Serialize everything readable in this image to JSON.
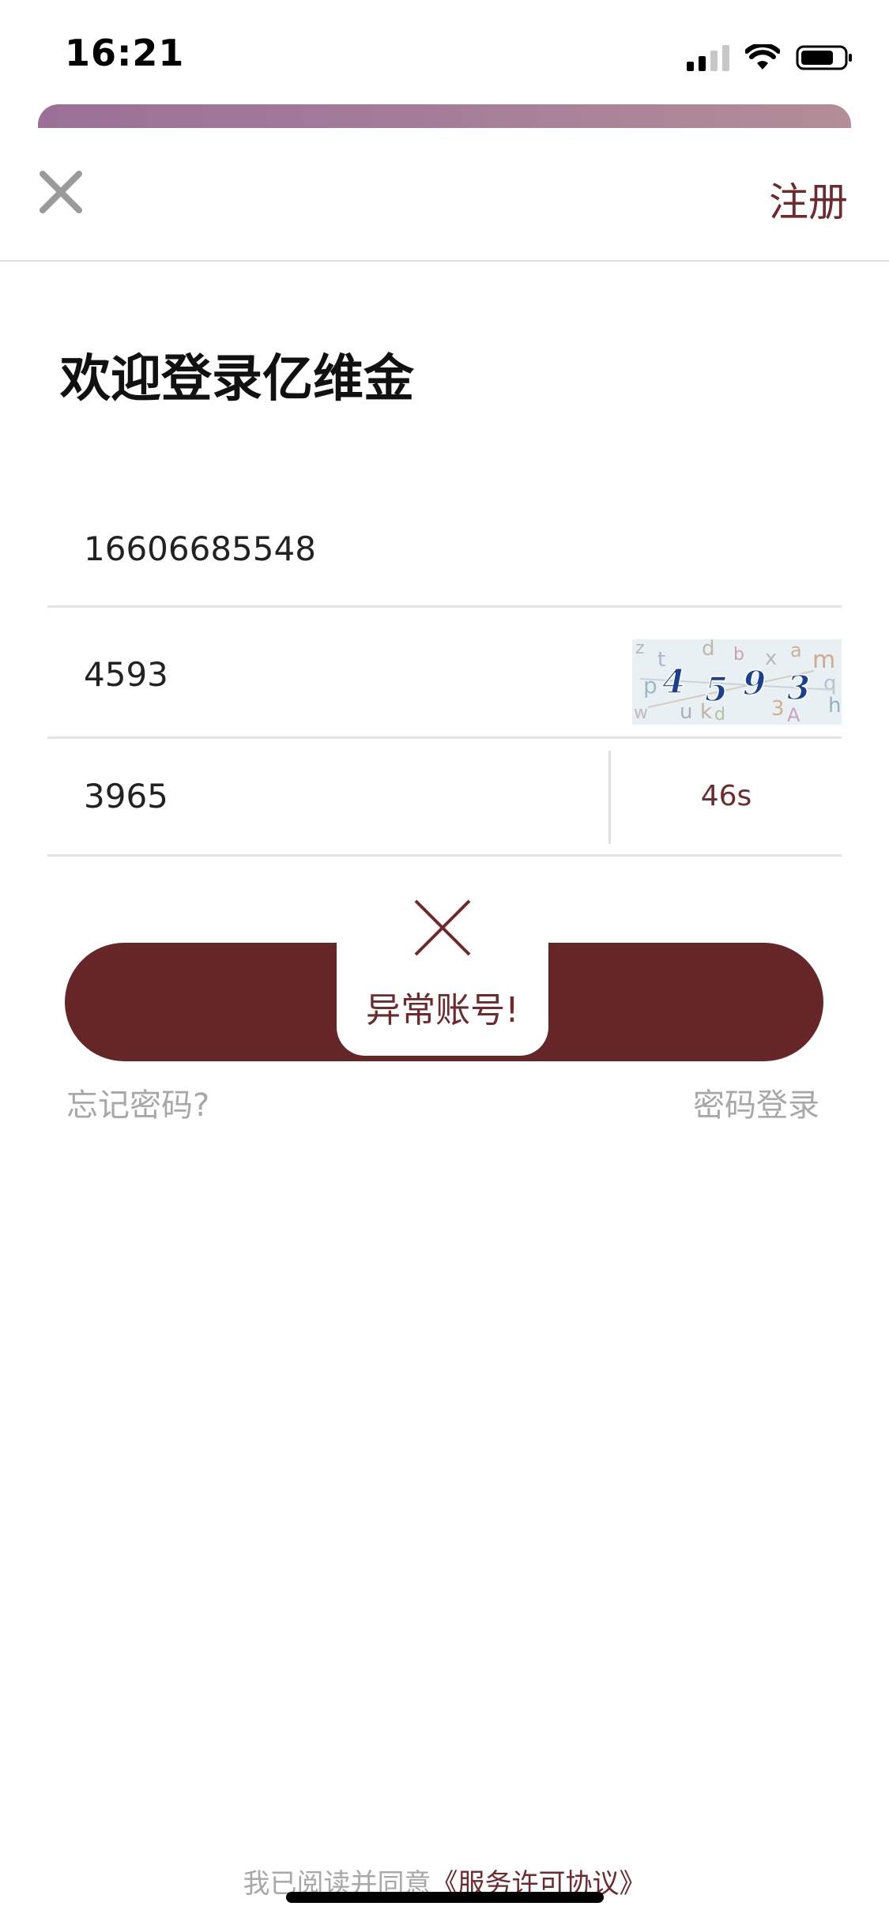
{
  "status_bar": {
    "time": "16:21"
  },
  "nav": {
    "close_icon": "close-icon",
    "register_label": "注册"
  },
  "title": "欢迎登录亿维金",
  "form": {
    "phone_value": "16606685548",
    "captcha_value": "4593",
    "captcha_image_text": "4593",
    "sms_code_value": "3965",
    "countdown": "46s"
  },
  "toast": {
    "icon": "close-icon",
    "message": "异常账号!"
  },
  "links": {
    "forgot_password": "忘记密码?",
    "password_login": "密码登录"
  },
  "agreement": {
    "prefix": "我已阅读并同意",
    "link": "《服务许可协议》"
  },
  "colors": {
    "brand": "#662628",
    "brand_text": "#6e2a2c",
    "muted_text": "#a8a8a8"
  }
}
